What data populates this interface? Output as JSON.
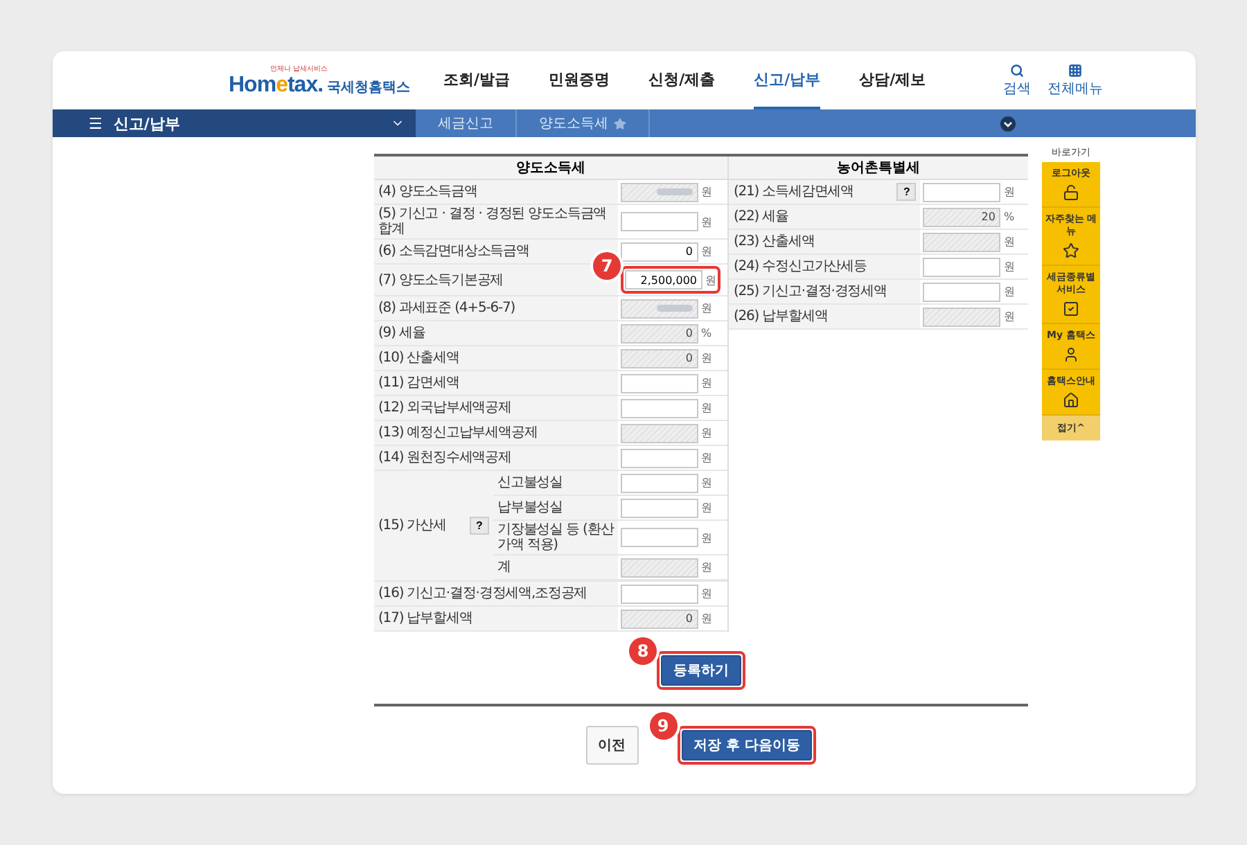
{
  "header": {
    "logo": {
      "tagline": "언제나 납세서비스",
      "word_a": "Hom",
      "word_e": "e",
      "word_b": "tax.",
      "name": "국세청홈택스"
    },
    "nav": [
      {
        "label": "조회/발급",
        "selected": false
      },
      {
        "label": "민원증명",
        "selected": false
      },
      {
        "label": "신청/제출",
        "selected": false
      },
      {
        "label": "신고/납부",
        "selected": true
      },
      {
        "label": "상담/제보",
        "selected": false
      }
    ],
    "tools": [
      {
        "kind": "search",
        "label": "검색"
      },
      {
        "kind": "grid",
        "label": "전체메뉴"
      }
    ]
  },
  "breadcrumb": {
    "menu_icon": "☰",
    "menu": "신고/납부",
    "items": [
      {
        "label": "세금신고",
        "starred": false
      },
      {
        "label": "양도소득세",
        "starred": true
      }
    ]
  },
  "left_table": {
    "title": "양도소득세",
    "rows": [
      {
        "label": "(4) 양도소득금액",
        "kind": "blurred",
        "unit": "원"
      },
      {
        "label": "(5) 기신고 · 결정 · 경정된 양도소득금액 합계",
        "kind": "input",
        "unit": "원"
      },
      {
        "label": "(6) 소득감면대상소득금액",
        "kind": "input",
        "value": "0",
        "unit": "원"
      },
      {
        "label": "(7) 양도소득기본공제",
        "kind": "input",
        "value": "2,500,000",
        "unit": "원",
        "callout": "7"
      },
      {
        "label": "(8) 과세표준 (4+5-6-7)",
        "kind": "blurred",
        "unit": "원"
      },
      {
        "label": "(9) 세율",
        "kind": "readonly",
        "value": "0",
        "unit": "%"
      },
      {
        "label": "(10) 산출세액",
        "kind": "readonly",
        "value": "0",
        "unit": "원"
      },
      {
        "label": "(11) 감면세액",
        "kind": "input",
        "unit": "원"
      },
      {
        "label": "(12) 외국납부세액공제",
        "kind": "input",
        "unit": "원"
      },
      {
        "label": "(13) 예정신고납부세액공제",
        "kind": "readonly",
        "unit": "원"
      },
      {
        "label": "(14) 원천징수세액공제",
        "kind": "input",
        "unit": "원"
      }
    ],
    "penalty": {
      "label": "(15) 가산세",
      "help": "?",
      "rows": [
        {
          "label": "신고불성실",
          "kind": "input",
          "unit": "원"
        },
        {
          "label": "납부불성실",
          "kind": "input",
          "unit": "원"
        },
        {
          "label": "기장불성실 등 (환산가액 적용)",
          "kind": "input",
          "unit": "원"
        },
        {
          "label": "계",
          "kind": "readonly",
          "unit": "원"
        }
      ]
    },
    "rows_after": [
      {
        "label": "(16) 기신고·결정·경정세액,조정공제",
        "kind": "input",
        "unit": "원"
      },
      {
        "label": "(17) 납부할세액",
        "kind": "readonly",
        "value": "0",
        "unit": "원"
      }
    ]
  },
  "right_table": {
    "title": "농어촌특별세",
    "rows": [
      {
        "label": "(21) 소득세감면세액",
        "help": "?",
        "kind": "input",
        "unit": "원"
      },
      {
        "label": "(22) 세율",
        "kind": "readonly",
        "value": "20",
        "unit": "%"
      },
      {
        "label": "(23) 산출세액",
        "kind": "readonly",
        "unit": "원"
      },
      {
        "label": "(24) 수정신고가산세등",
        "kind": "input",
        "unit": "원"
      },
      {
        "label": "(25) 기신고·결정·경정세액",
        "kind": "input",
        "unit": "원"
      },
      {
        "label": "(26) 납부할세액",
        "kind": "readonly",
        "unit": "원"
      }
    ]
  },
  "register_button": {
    "label": "등록하기",
    "callout": "8"
  },
  "footer_buttons": [
    {
      "label": "이전",
      "primary": false
    },
    {
      "label": "저장 후 다음이동",
      "primary": true,
      "callout": "9"
    }
  ],
  "quick_menu": {
    "title": "바로가기",
    "items": [
      {
        "label": "로그아웃"
      },
      {
        "label": "자주찾는 메뉴"
      },
      {
        "label": "세금종류별 서비스"
      },
      {
        "label": "My 홈택스"
      },
      {
        "label": "홈택스안내"
      }
    ],
    "collapse": "접기^"
  }
}
